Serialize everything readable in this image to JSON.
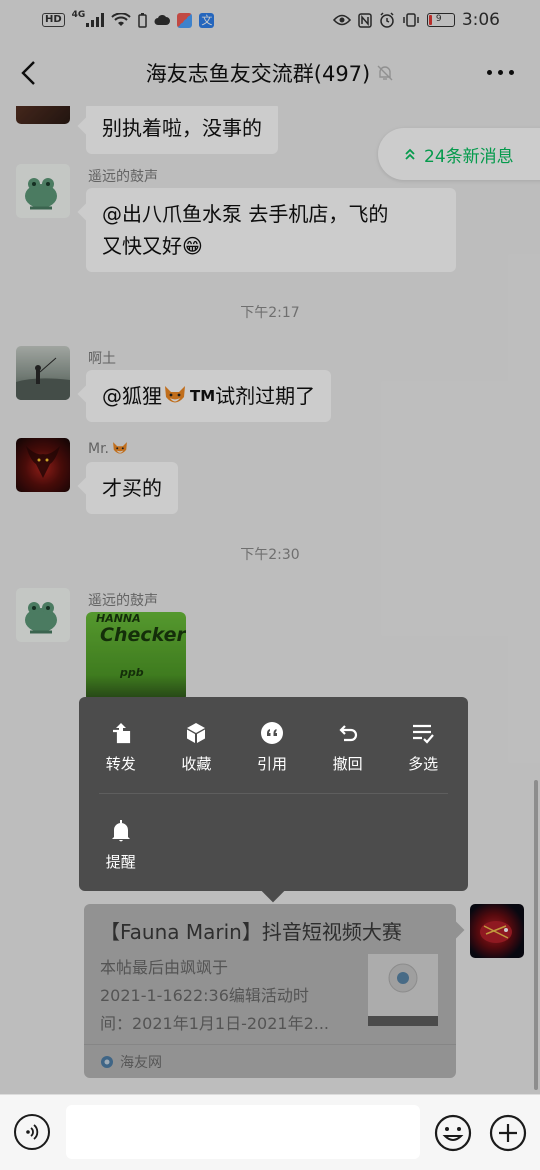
{
  "status_bar": {
    "left_icons": [
      "hd-badge",
      "signal-icon",
      "wifi-icon",
      "battery-saver-icon",
      "cloud-icon",
      "app-icon",
      "translate-icon"
    ],
    "hd_label": "HD",
    "network_label": "4G",
    "right_icons": [
      "eye-icon",
      "nfc-icon",
      "alarm-icon",
      "vibrate-icon"
    ],
    "battery_level": "9",
    "time": "3:06"
  },
  "nav": {
    "title": "海友志鱼友交流群(497)",
    "muted_icon": "bell-muted-icon",
    "back_icon": "chevron-left-icon",
    "more_icon": "more-horizontal-icon"
  },
  "new_messages": {
    "label": "24条新消息",
    "icon": "double-chevron-up-icon"
  },
  "messages": [
    {
      "sender": "",
      "text": "别执着啦，没事的"
    },
    {
      "sender": "遥远的鼓声",
      "line1": "@出八爪鱼水泵  去手机店，飞的",
      "line2": "又快又好😁"
    },
    {
      "time": "下午2:17"
    },
    {
      "sender": "啊土",
      "text_before": "@狐狸",
      "text_after": " 试剂过期了",
      "emoji": "fox-emoji",
      "tm": "TM"
    },
    {
      "sender": "Mr. ",
      "text": "才买的"
    },
    {
      "time": "下午2:30"
    },
    {
      "sender": "遥远的鼓声",
      "image_text_1": "HANNA",
      "image_text_2": "Checker",
      "image_text_3": "ppb"
    }
  ],
  "context_menu": {
    "items": [
      {
        "label": "转发",
        "icon": "forward-icon"
      },
      {
        "label": "收藏",
        "icon": "favorite-box-icon"
      },
      {
        "label": "引用",
        "icon": "quote-icon"
      },
      {
        "label": "撤回",
        "icon": "recall-icon"
      },
      {
        "label": "多选",
        "icon": "multiselect-icon"
      },
      {
        "label": "提醒",
        "icon": "bell-icon"
      }
    ]
  },
  "link_card": {
    "title": "【Fauna Marin】抖音短视频大赛",
    "desc_line1": "本帖最后由飒飒于",
    "desc_line2": "2021-1-1622:36编辑活动时",
    "desc_line3": "间：2021年1月1日-2021年2...",
    "source": "海友网"
  },
  "input_bar": {
    "voice_icon": "voice-icon",
    "emoji_icon": "emoji-icon",
    "plus_icon": "plus-icon"
  },
  "colors": {
    "accent_green": "#07c160",
    "menu_bg": "#4c4c4c",
    "chat_bg": "#ededed"
  }
}
